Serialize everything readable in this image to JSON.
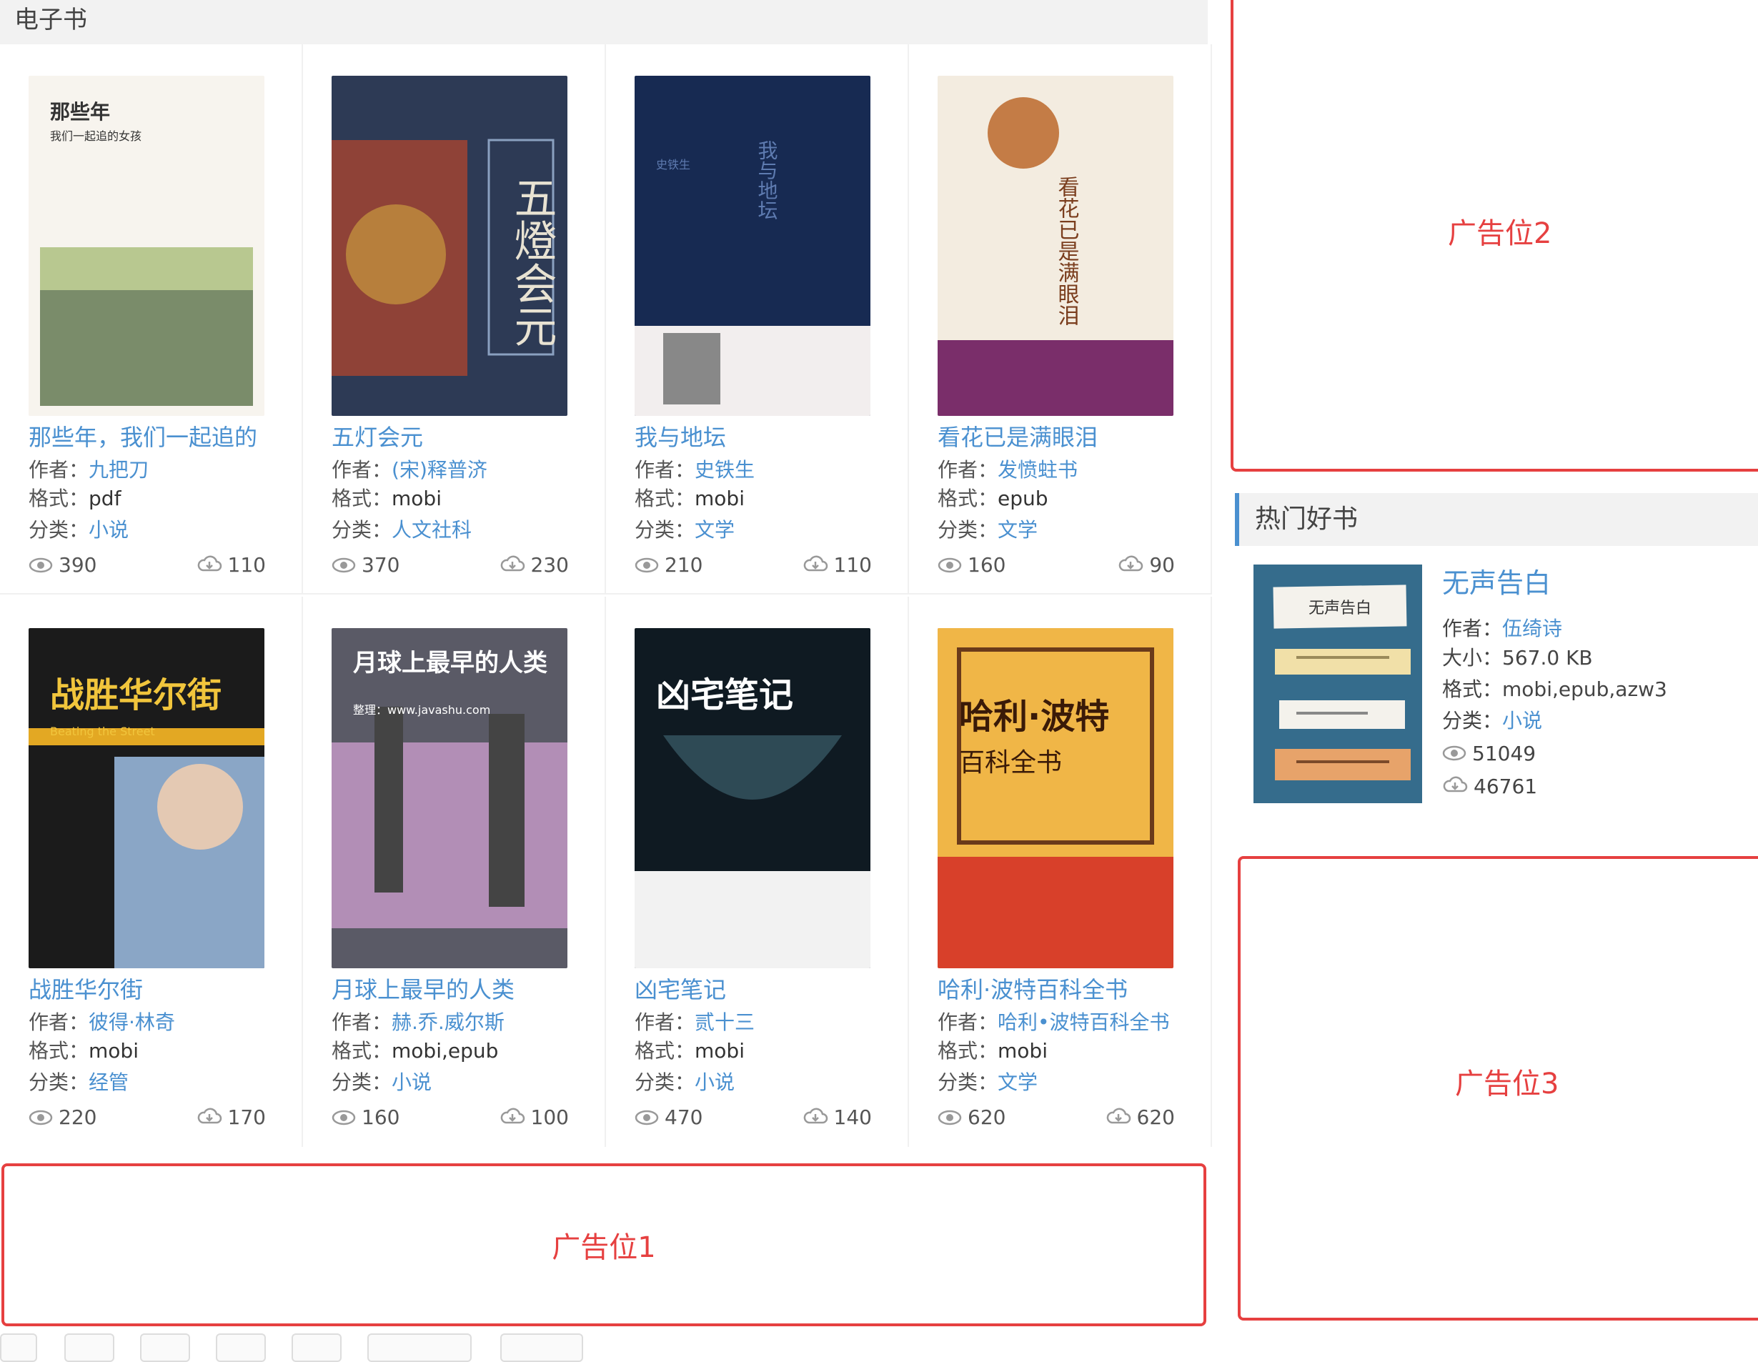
{
  "section": {
    "title": "电子书"
  },
  "labels": {
    "author": "作者：",
    "format": "格式：",
    "category": "分类：",
    "size": "大小："
  },
  "books": [
    {
      "title": "那些年，我们一起追的",
      "author": "九把刀",
      "format": "pdf",
      "category": "小说",
      "views": "390",
      "downloads": "110",
      "cover": {
        "text": "那些年",
        "subtitle": "我们一起追的女孩",
        "bg": "#f7f4ee",
        "accent": "#e07b2a",
        "fg": "#333"
      }
    },
    {
      "title": "五灯会元",
      "author": "(宋)释普济",
      "format": "mobi",
      "category": "人文社科",
      "views": "370",
      "downloads": "230",
      "cover": {
        "text": "五燈会元",
        "subtitle": "",
        "bg": "#2d3a55",
        "accent": "#a8452f",
        "fg": "#e8e2d2"
      }
    },
    {
      "title": "我与地坛",
      "author": "史铁生",
      "format": "mobi",
      "category": "文学",
      "views": "210",
      "downloads": "110",
      "cover": {
        "text": "我与地坛",
        "subtitle": "史铁生",
        "bg": "#172a52",
        "accent": "#f2eeee",
        "fg": "#5e7bb0"
      }
    },
    {
      "title": "看花已是满眼泪",
      "author": "发愤蛀书",
      "format": "epub",
      "category": "文学",
      "views": "160",
      "downloads": "90",
      "cover": {
        "text": "看花已是满眼泪",
        "subtitle": "",
        "bg": "#f3ece0",
        "accent": "#7a2e6a",
        "fg": "#7a3d1d"
      }
    },
    {
      "title": "战胜华尔街",
      "author": "彼得·林奇",
      "format": "mobi",
      "category": "经管",
      "views": "220",
      "downloads": "170",
      "cover": {
        "text": "战胜华尔街",
        "subtitle": "Beating the Street",
        "bg": "#1b1b1b",
        "accent": "#e3a823",
        "fg": "#f1c53c"
      }
    },
    {
      "title": "月球上最早的人类",
      "author": "赫.乔.威尔斯",
      "format": "mobi,epub",
      "category": "小说",
      "views": "160",
      "downloads": "100",
      "cover": {
        "text": "月球上最早的人类",
        "subtitle": "整理：www.javashu.com",
        "bg": "#5a5a66",
        "accent": "#d7a4d8",
        "fg": "#ffffff"
      }
    },
    {
      "title": "凶宅笔记",
      "author": "贰十三",
      "format": "mobi",
      "category": "小说",
      "views": "470",
      "downloads": "140",
      "cover": {
        "text": "凶宅笔记",
        "subtitle": "",
        "bg": "#0f1a22",
        "accent": "#f2f2f2",
        "fg": "#ffffff"
      }
    },
    {
      "title": "哈利·波特百科全书",
      "author": "哈利•波特百科全书",
      "format": "mobi",
      "category": "文学",
      "views": "620",
      "downloads": "620",
      "cover": {
        "text": "哈利·波特",
        "subtitle": "百科全书",
        "bg": "#d8402a",
        "accent": "#f3c34a",
        "fg": "#3a1a08"
      }
    }
  ],
  "ads": {
    "ad1": "广告位1",
    "ad2": "广告位2",
    "ad3": "广告位3"
  },
  "hot": {
    "title": "热门好书",
    "book": {
      "title": "无声告白",
      "author": "伍绮诗",
      "size": "567.0 KB",
      "format": "mobi,epub,azw3",
      "category": "小说",
      "views": "51049",
      "downloads": "46761",
      "cover_text": "无声告白"
    }
  },
  "colors": {
    "link": "#4a90d0",
    "ad": "#e64040"
  }
}
